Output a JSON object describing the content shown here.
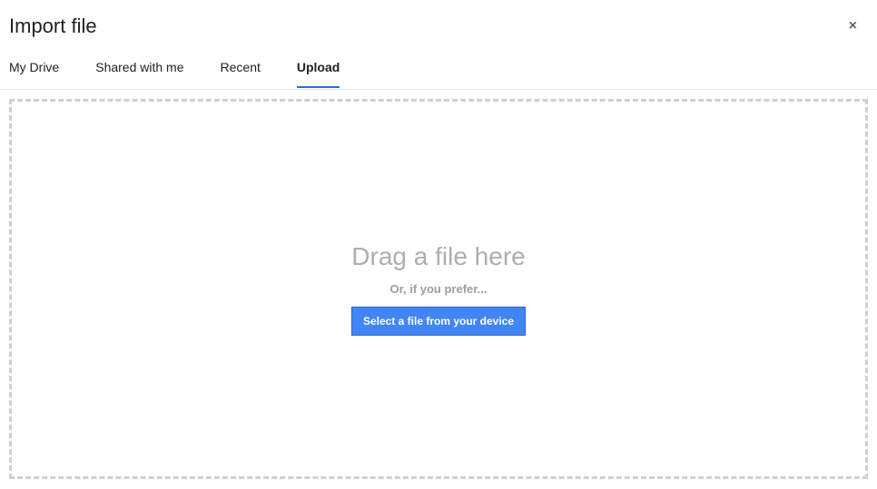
{
  "dialog": {
    "title": "Import file",
    "close_icon": "×"
  },
  "tabs": {
    "items": [
      {
        "label": "My Drive"
      },
      {
        "label": "Shared with me"
      },
      {
        "label": "Recent"
      },
      {
        "label": "Upload"
      }
    ],
    "active_index": 3
  },
  "upload": {
    "drag_text": "Drag a file here",
    "or_text": "Or, if you prefer...",
    "select_button_label": "Select a file from your device"
  }
}
